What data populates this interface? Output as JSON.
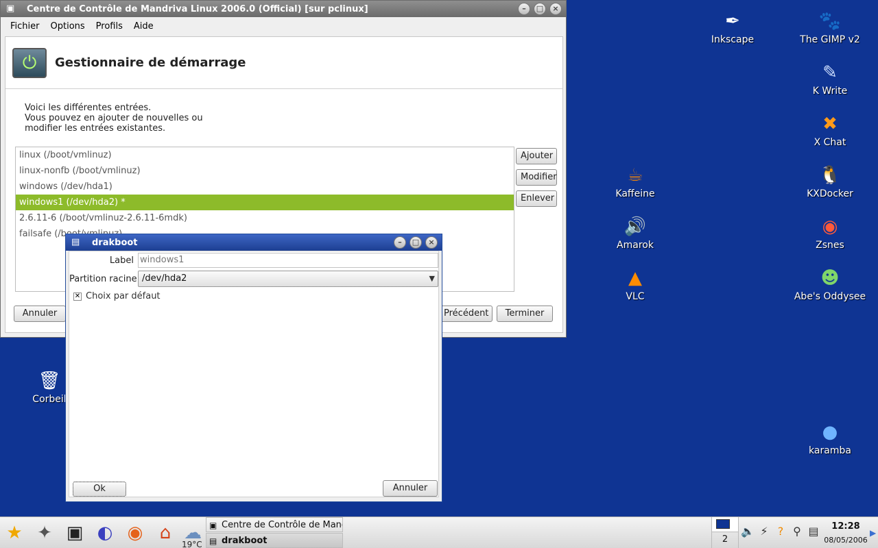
{
  "desktop": {
    "icons": [
      {
        "label": "Inkscape",
        "glyph": "✒"
      },
      {
        "label": "The GIMP v2",
        "glyph": "🐾"
      },
      {
        "label": "K Write",
        "glyph": "✎"
      },
      {
        "label": "X Chat",
        "glyph": "✖"
      },
      {
        "label": "Kaffeine",
        "glyph": "☕"
      },
      {
        "label": "KXDocker",
        "glyph": "🐧"
      },
      {
        "label": "Amarok",
        "glyph": "🔊"
      },
      {
        "label": "Zsnes",
        "glyph": "◉"
      },
      {
        "label": "VLC",
        "glyph": "▲"
      },
      {
        "label": "Abe's Oddysee",
        "glyph": "☻"
      },
      {
        "label": "Corbeil",
        "glyph": "🗑"
      },
      {
        "label": "karamba",
        "glyph": "●"
      }
    ]
  },
  "main_window": {
    "title": "Centre de Contrôle de Mandriva Linux 2006.0 (Official) [sur pclinux]",
    "menu": [
      "Fichier",
      "Options",
      "Profils",
      "Aide"
    ],
    "banner_title": "Gestionnaire de démarrage",
    "intro": [
      "Voici les différentes entrées.",
      "Vous pouvez en ajouter de nouvelles ou",
      "modifier les entrées existantes."
    ],
    "entries": [
      "linux (/boot/vmlinuz)",
      "linux-nonfb (/boot/vmlinuz)",
      "windows (/dev/hda1)",
      "windows1 (/dev/hda2)  *",
      "2.6.11-6 (/boot/vmlinuz-2.6.11-6mdk)",
      "failsafe (/boot/vmlinuz)"
    ],
    "selected_entry": 3,
    "side_buttons": {
      "add": "Ajouter",
      "modify": "Modifier",
      "remove": "Enlever"
    },
    "bottom_buttons": {
      "cancel": "Annuler",
      "previous": "Précédent",
      "finish": "Terminer"
    }
  },
  "dialog": {
    "title": "drakboot",
    "label_label": "Label",
    "label_value": "windows1",
    "root_partition_label": "Partition racine",
    "root_partition_value": "/dev/hda2",
    "default_checkbox_label": "Choix par défaut",
    "default_checked": true,
    "ok_label": "Ok",
    "cancel_label": "Annuler"
  },
  "taskbar": {
    "weather_temp": "19°C",
    "tasks": [
      "Centre de Contrôle de Mandriva Linux",
      "drakboot"
    ],
    "pager_desktop": "2",
    "clock_time": "12:28",
    "clock_date": "08/05/2006"
  }
}
